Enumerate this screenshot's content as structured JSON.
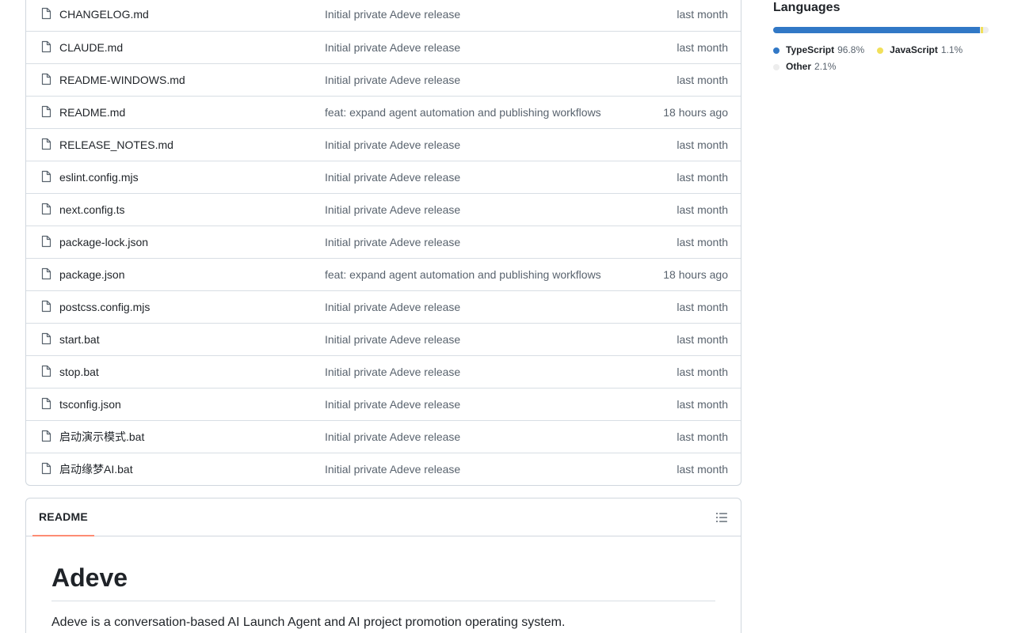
{
  "files": [
    {
      "name": "CHANGELOG.md",
      "message": "Initial private Adeve release",
      "time": "last month"
    },
    {
      "name": "CLAUDE.md",
      "message": "Initial private Adeve release",
      "time": "last month"
    },
    {
      "name": "README-WINDOWS.md",
      "message": "Initial private Adeve release",
      "time": "last month"
    },
    {
      "name": "README.md",
      "message": "feat: expand agent automation and publishing workflows",
      "time": "18 hours ago"
    },
    {
      "name": "RELEASE_NOTES.md",
      "message": "Initial private Adeve release",
      "time": "last month"
    },
    {
      "name": "eslint.config.mjs",
      "message": "Initial private Adeve release",
      "time": "last month"
    },
    {
      "name": "next.config.ts",
      "message": "Initial private Adeve release",
      "time": "last month"
    },
    {
      "name": "package-lock.json",
      "message": "Initial private Adeve release",
      "time": "last month"
    },
    {
      "name": "package.json",
      "message": "feat: expand agent automation and publishing workflows",
      "time": "18 hours ago"
    },
    {
      "name": "postcss.config.mjs",
      "message": "Initial private Adeve release",
      "time": "last month"
    },
    {
      "name": "start.bat",
      "message": "Initial private Adeve release",
      "time": "last month"
    },
    {
      "name": "stop.bat",
      "message": "Initial private Adeve release",
      "time": "last month"
    },
    {
      "name": "tsconfig.json",
      "message": "Initial private Adeve release",
      "time": "last month"
    },
    {
      "name": "启动演示模式.bat",
      "message": "Initial private Adeve release",
      "time": "last month"
    },
    {
      "name": "启动缘梦AI.bat",
      "message": "Initial private Adeve release",
      "time": "last month"
    }
  ],
  "file_icon": "file-icon",
  "readme": {
    "tab_label": "README",
    "toc_icon": "list-unordered-icon",
    "title": "Adeve",
    "description": "Adeve is a conversation-based AI Launch Agent and AI project promotion operating system."
  },
  "languages": {
    "heading": "Languages",
    "items": [
      {
        "name": "TypeScript",
        "percent": "96.8%",
        "value": 96.8,
        "color": "#3178c6"
      },
      {
        "name": "JavaScript",
        "percent": "1.1%",
        "value": 1.1,
        "color": "#f1e05a"
      },
      {
        "name": "Other",
        "percent": "2.1%",
        "value": 2.1,
        "color": "#ededed"
      }
    ]
  }
}
